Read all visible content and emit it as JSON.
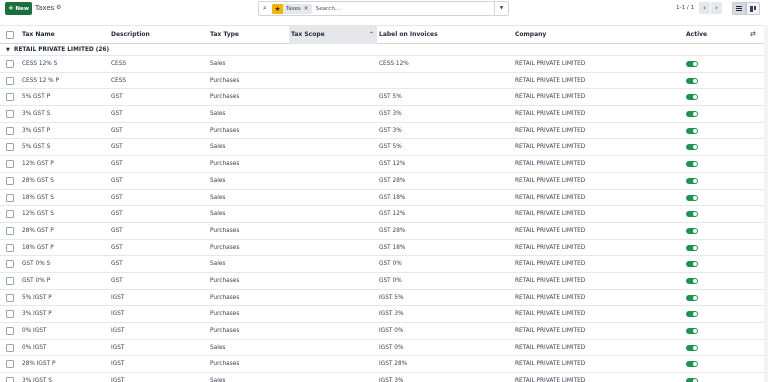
{
  "control_panel": {
    "new_label": "New",
    "title": "Taxes",
    "search": {
      "facet_value": "Taxes",
      "placeholder": "Search..."
    },
    "pager": "1-1 / 1"
  },
  "table": {
    "columns": {
      "name": "Tax Name",
      "description": "Description",
      "type": "Tax Type",
      "scope": "Tax Scope",
      "label": "Label on Invoices",
      "company": "Company",
      "active": "Active"
    },
    "group": {
      "label": "RETAIL PRIVATE LIMITED (26)"
    },
    "rows": [
      {
        "name": "CESS 12% S",
        "description": "CESS",
        "type": "Sales",
        "label": "CESS 12%",
        "company": "RETAIL PRIVATE LIMITED",
        "active": true
      },
      {
        "name": "CESS 12 % P",
        "description": "CESS",
        "type": "Purchases",
        "label": "",
        "company": "RETAIL PRIVATE LIMITED",
        "active": true
      },
      {
        "name": "5% GST P",
        "description": "GST",
        "type": "Purchases",
        "label": "GST 5%",
        "company": "RETAIL PRIVATE LIMITED",
        "active": true
      },
      {
        "name": "3% GST S",
        "description": "GST",
        "type": "Sales",
        "label": "GST 3%",
        "company": "RETAIL PRIVATE LIMITED",
        "active": true
      },
      {
        "name": "3% GST P",
        "description": "GST",
        "type": "Purchases",
        "label": "GST 3%",
        "company": "RETAIL PRIVATE LIMITED",
        "active": true
      },
      {
        "name": "5% GST S",
        "description": "GST",
        "type": "Sales",
        "label": "GST 5%",
        "company": "RETAIL PRIVATE LIMITED",
        "active": true
      },
      {
        "name": "12% GST P",
        "description": "GST",
        "type": "Purchases",
        "label": "GST 12%",
        "company": "RETAIL PRIVATE LIMITED",
        "active": true
      },
      {
        "name": "28% GST S",
        "description": "GST",
        "type": "Sales",
        "label": "GST 28%",
        "company": "RETAIL PRIVATE LIMITED",
        "active": true
      },
      {
        "name": "18% GST S",
        "description": "GST",
        "type": "Sales",
        "label": "GST 18%",
        "company": "RETAIL PRIVATE LIMITED",
        "active": true
      },
      {
        "name": "12% GST S",
        "description": "GST",
        "type": "Sales",
        "label": "GST 12%",
        "company": "RETAIL PRIVATE LIMITED",
        "active": true
      },
      {
        "name": "28% GST P",
        "description": "GST",
        "type": "Purchases",
        "label": "GST 28%",
        "company": "RETAIL PRIVATE LIMITED",
        "active": true
      },
      {
        "name": "18% GST P",
        "description": "GST",
        "type": "Purchases",
        "label": "GST 18%",
        "company": "RETAIL PRIVATE LIMITED",
        "active": true
      },
      {
        "name": "GST 0% S",
        "description": "GST",
        "type": "Sales",
        "label": "GST 0%",
        "company": "RETAIL PRIVATE LIMITED",
        "active": true
      },
      {
        "name": "GST 0% P",
        "description": "GST",
        "type": "Purchases",
        "label": "GST 0%",
        "company": "RETAIL PRIVATE LIMITED",
        "active": true
      },
      {
        "name": "5% IGST P",
        "description": "IGST",
        "type": "Purchases",
        "label": "IGST 5%",
        "company": "RETAIL PRIVATE LIMITED",
        "active": true
      },
      {
        "name": "3% IGST P",
        "description": "IGST",
        "type": "Purchases",
        "label": "IGST 3%",
        "company": "RETAIL PRIVATE LIMITED",
        "active": true
      },
      {
        "name": "0% IGST",
        "description": "IGST",
        "type": "Purchases",
        "label": "IGST 0%",
        "company": "RETAIL PRIVATE LIMITED",
        "active": true
      },
      {
        "name": "0% IGST",
        "description": "IGST",
        "type": "Sales",
        "label": "IGST 0%",
        "company": "RETAIL PRIVATE LIMITED",
        "active": true
      },
      {
        "name": "28% IGST P",
        "description": "IGST",
        "type": "Purchases",
        "label": "IGST 28%",
        "company": "RETAIL PRIVATE LIMITED",
        "active": true
      },
      {
        "name": "3% IGST S",
        "description": "IGST",
        "type": "Sales",
        "label": "IGST 3%",
        "company": "RETAIL PRIVATE LIMITED",
        "active": true
      }
    ]
  },
  "colors": {
    "primary_button": "#1c6e3d",
    "toggle_on": "#1f9254",
    "facet_star": "#f3b400"
  }
}
